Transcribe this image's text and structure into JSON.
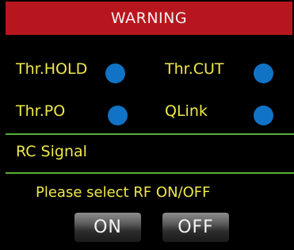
{
  "header": {
    "title": "WARNING",
    "color": "#b8161e"
  },
  "status_items": [
    {
      "label": "Thr.HOLD",
      "indicator_color": "#1173c6"
    },
    {
      "label": "Thr.CUT",
      "indicator_color": "#1173c6"
    },
    {
      "label": "Thr.PO",
      "indicator_color": "#1173c6"
    },
    {
      "label": "QLink",
      "indicator_color": "#1173c6"
    }
  ],
  "rc_signal": {
    "label": "RC Signal"
  },
  "prompt": {
    "text": "Please select RF ON/OFF"
  },
  "buttons": {
    "on_label": "ON",
    "off_label": "OFF"
  },
  "colors": {
    "text": "#f0e84a",
    "divider": "#58ad34",
    "background": "#000000"
  }
}
